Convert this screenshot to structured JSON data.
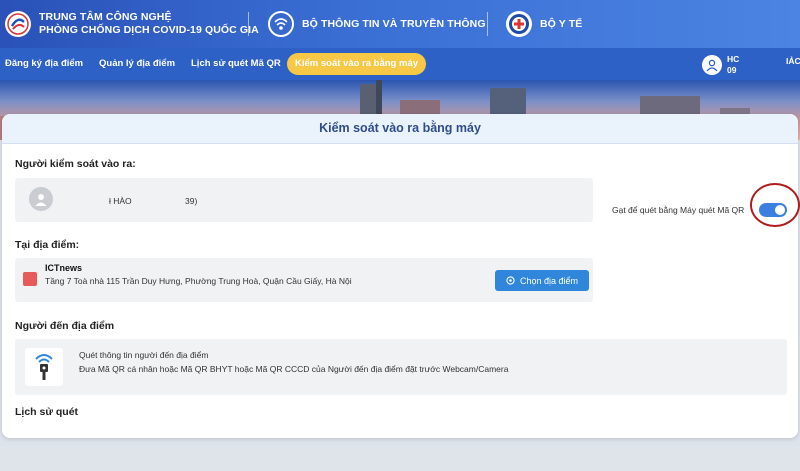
{
  "header": {
    "org1": {
      "line1": "TRUNG TÂM CÔNG NGHỆ",
      "line2": "PHÒNG CHỐNG DỊCH COVID-19 QUỐC GIA"
    },
    "org2": "BỘ THÔNG TIN VÀ TRUYỀN THÔNG",
    "org3": "BỘ Y TẾ"
  },
  "nav": {
    "items": [
      "Đăng ký địa điểm",
      "Quản lý địa điểm",
      "Lịch sử quét Mã QR"
    ],
    "active": "Kiểm soát vào ra bằng máy"
  },
  "user": {
    "line1": "HC",
    "line2": "09",
    "extra": "IẢC"
  },
  "card": {
    "title": "Kiểm soát vào ra bằng máy",
    "controller": {
      "label": "Người kiểm soát vào ra:",
      "name": "ł HÀO",
      "phone": "39)"
    },
    "location": {
      "label": "Tại địa điểm:",
      "name": "ICTnews",
      "address": "Tầng 7 Toà nhà 115 Trần Duy Hưng, Phường Trung Hoà, Quận Cầu Giấy, Hà Nội",
      "button": "Chọn địa điểm"
    },
    "arrivals": {
      "label": "Người đến địa điểm",
      "toggle_label": "Gạt để quét bằng Máy quét Mã QR",
      "toggle_on": true,
      "scan_title": "Quét thông tin người đến địa điểm",
      "scan_desc": "Đưa Mã QR cá nhân hoặc Mã QR BHYT hoặc Mã QR CCCD của Người đến địa điểm đặt trước Webcam/Camera"
    },
    "history": {
      "label": "Lịch sử quét"
    }
  },
  "colors": {
    "primary": "#2e61c6",
    "active_tab": "#f7c846",
    "button": "#2f86db",
    "location_icon": "#e65a5a",
    "highlight_ring": "#b01b1b"
  }
}
